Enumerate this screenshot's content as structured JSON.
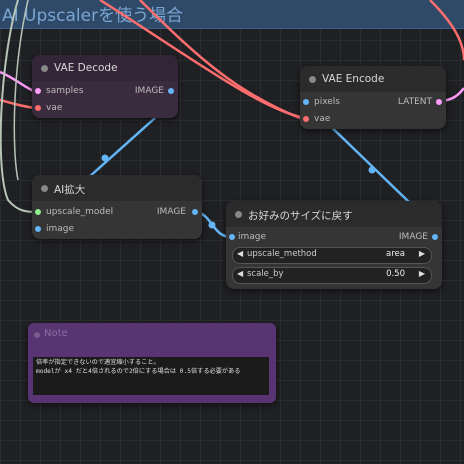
{
  "group": {
    "title": "AI Upscalerを使う場合"
  },
  "nodes": {
    "vae_decode": {
      "title": "VAE Decode",
      "inputs": [
        "samples",
        "vae"
      ],
      "output": "IMAGE"
    },
    "vae_encode": {
      "title": "VAE Encode",
      "inputs": [
        "pixels",
        "vae"
      ],
      "output": "LATENT"
    },
    "ai_upscale": {
      "title": "AI拡大",
      "inputs": [
        "upscale_model",
        "image"
      ],
      "output": "IMAGE"
    },
    "resize": {
      "title": "お好みのサイズに戻す",
      "input": "image",
      "output": "IMAGE",
      "widgets": [
        {
          "label": "upscale_method",
          "value": "area"
        },
        {
          "label": "scale_by",
          "value": "0.50"
        }
      ]
    }
  },
  "note": {
    "title": "Note",
    "line1": "倍率が指定できないので適宜縮小すること。",
    "line2": "modelが x4 だと4倍されるので2倍にする場合は 0.5倍する必要がある"
  },
  "colors": {
    "image_wire": "#64b5f6",
    "vae_wire": "#ff6e6e",
    "latent_wire": "#ff9cf9",
    "model_wire": "#b8c4b8",
    "group_title": "#7aa4d2",
    "note_bg": "#583473"
  },
  "icons": [
    "left-arrow-icon",
    "right-arrow-icon",
    "node-collapse-dot-icon"
  ]
}
